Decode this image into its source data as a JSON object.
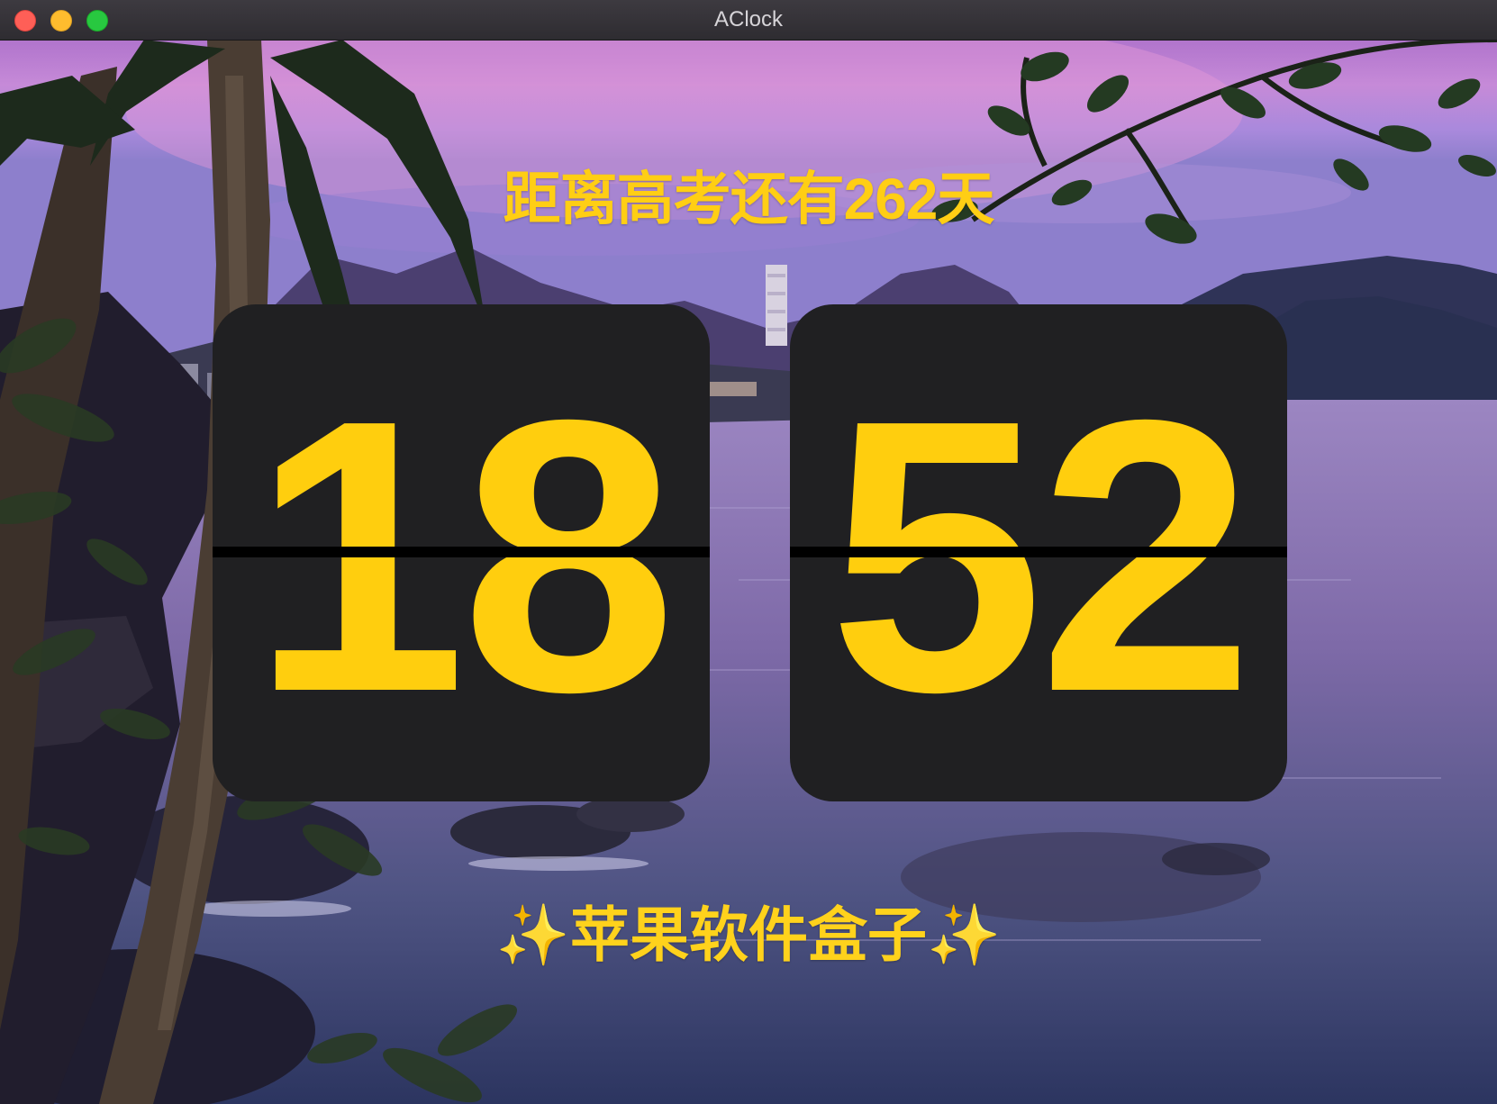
{
  "window": {
    "title": "AClock"
  },
  "controls": {
    "close": "close-icon",
    "minimize": "minimize-icon",
    "maximize": "maximize-icon"
  },
  "countdown": {
    "text": "距离高考还有262天"
  },
  "clock": {
    "hours": "18",
    "minutes": "52"
  },
  "brand": {
    "text": "✨苹果软件盒子✨"
  },
  "colors": {
    "accent": "#ffce14",
    "card": "#202022",
    "split": "#000000",
    "close": "#fe5f57",
    "minimize": "#febc2e",
    "maximize": "#28c840"
  }
}
